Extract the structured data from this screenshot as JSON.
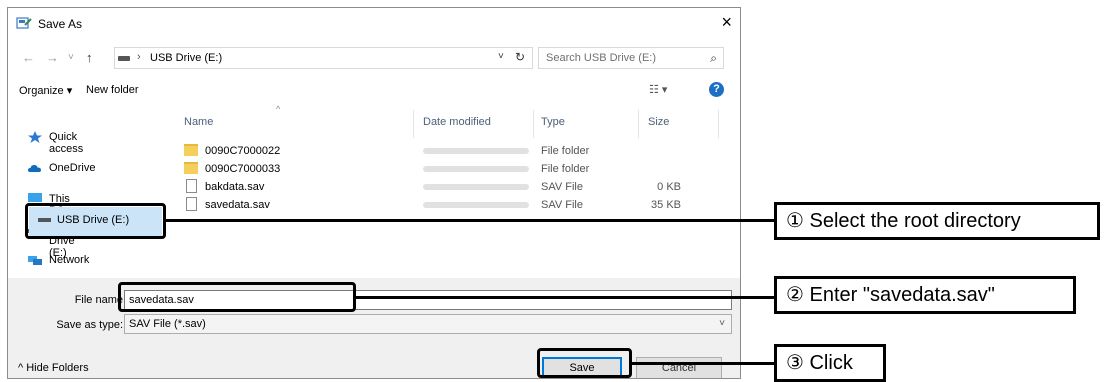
{
  "window": {
    "title": "Save As",
    "close_glyph": "×"
  },
  "address": {
    "back_glyph": "←",
    "forward_glyph": "→",
    "recent_glyph": "˅",
    "up_glyph": "↑",
    "separator": "›",
    "location": "USB Drive (E:)",
    "dropdown_glyph": "˅",
    "refresh_glyph": "↻",
    "search_placeholder": "Search USB Drive (E:)",
    "search_icon": "⌕"
  },
  "toolbar": {
    "organize": "Organize ▾",
    "new_folder": "New folder",
    "view_glyph": "☷ ▾",
    "help": "?"
  },
  "nav": {
    "items": [
      {
        "label": "Quick access",
        "icon": "star-icon"
      },
      {
        "label": "OneDrive",
        "icon": "cloud-icon"
      },
      {
        "label": "This PC",
        "icon": "monitor-icon"
      },
      {
        "label": "USB Drive (E:)",
        "icon": "drive-icon"
      },
      {
        "label": "Network",
        "icon": "network-icon"
      }
    ]
  },
  "files": {
    "columns": {
      "name": "Name",
      "date": "Date modified",
      "type": "Type",
      "size": "Size",
      "sort_glyph": "^"
    },
    "rows": [
      {
        "name": "0090C7000022",
        "type": "File folder",
        "size": ""
      },
      {
        "name": "0090C7000033",
        "type": "File folder",
        "size": ""
      },
      {
        "name": "bakdata.sav",
        "type": "SAV File",
        "size": "0 KB"
      },
      {
        "name": "savedata.sav",
        "type": "SAV File",
        "size": "35 KB"
      }
    ]
  },
  "form": {
    "filename_label": "File name",
    "filename_value": "savedata.sav",
    "type_label": "Save as type:",
    "type_value": "SAV File (*.sav)",
    "type_arrow": "˅"
  },
  "footer": {
    "hide_folders": "^ Hide Folders",
    "save": "Save",
    "cancel": "Cancel"
  },
  "callouts": [
    "① Select the root directory",
    "② Enter \"savedata.sav\"",
    "③ Click"
  ]
}
